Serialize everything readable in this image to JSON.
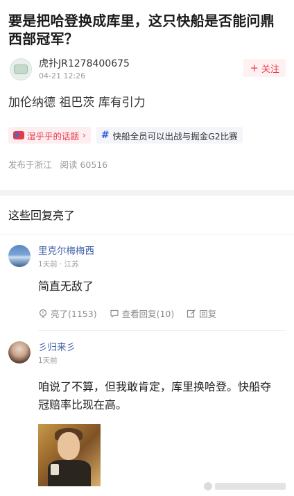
{
  "post": {
    "title": "要是把哈登换成库里，这只快船是否能问鼎西部冠军？",
    "author": {
      "name": "虎扑JR1278400675",
      "time": "04-21 12:26"
    },
    "follow_label": "关注",
    "body": "加伦纳德 祖巴茨 库有引力",
    "tags": [
      {
        "label": "湿乎乎的话题"
      },
      {
        "label": "快船全员可以出战与掘金G2比赛"
      }
    ],
    "location": "发布于浙江",
    "reads": "阅读 60516"
  },
  "section": {
    "title": "这些回复亮了"
  },
  "replies": [
    {
      "name": "里克尔梅梅西",
      "sub": "1天前 · 江苏",
      "text": "简直无敌了",
      "like_label": "亮了(1153)",
      "view_replies_label": "查看回复(10)",
      "reply_label": "回复"
    },
    {
      "name": "彡归来彡",
      "sub": "1天前",
      "text": "咱说了不算，但我敢肯定，库里换哈登。快船夺冠赔率比现在高。"
    }
  ],
  "colors": {
    "accent_red": "#e83a4c",
    "link_blue": "#3f5fa8",
    "hash_blue": "#2e63d6"
  },
  "icons": {
    "follow": "plus-icon",
    "topic_tag": "chat-bubble-icon",
    "topic_arrow": "chevron-right-icon",
    "hash_tag": "hash-icon",
    "like": "lightbulb-icon",
    "view_replies": "comment-icon",
    "reply": "edit-icon"
  }
}
